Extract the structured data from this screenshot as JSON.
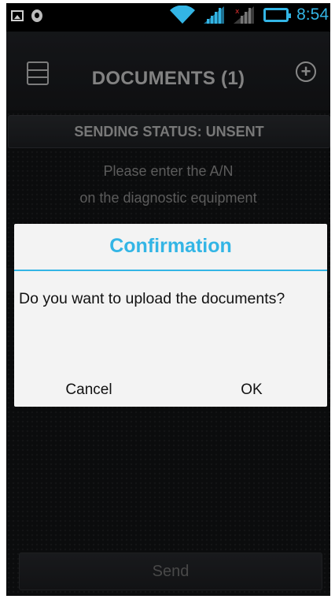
{
  "statusbar": {
    "time": "8:54",
    "icons": [
      "gallery-icon",
      "shield-icon",
      "wifi-icon",
      "signal-icon",
      "no-signal-icon",
      "battery-icon"
    ]
  },
  "header": {
    "title": "DOCUMENTS (1)",
    "menu_icon": "list-icon",
    "add_icon": "plus-circle-icon"
  },
  "sending_status": "SENDING STATUS: UNSENT",
  "instruction": {
    "line1": "Please enter the A/N",
    "line2": "on the diagnostic equipment"
  },
  "send_label": "Send",
  "dialog": {
    "title": "Confirmation",
    "message": "Do you want to upload the documents?",
    "cancel_label": "Cancel",
    "ok_label": "OK"
  },
  "colors": {
    "accent": "#33b5e5",
    "background": "#121314",
    "dialog_bg": "#f3f3f3"
  }
}
